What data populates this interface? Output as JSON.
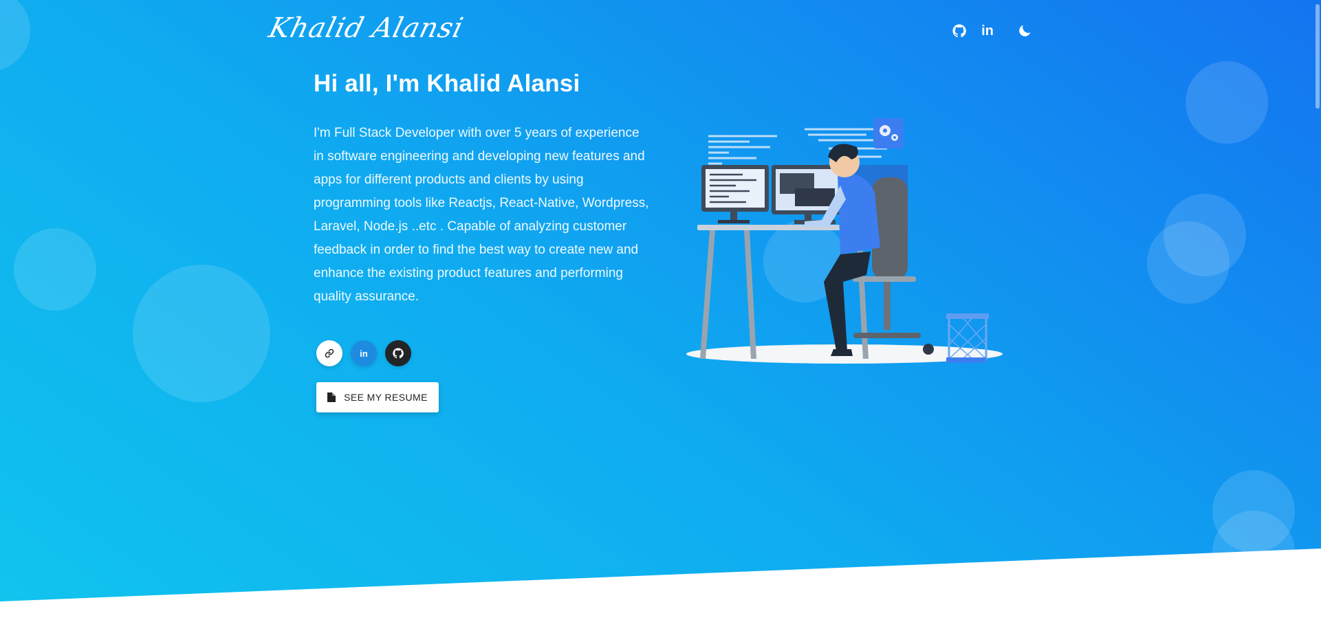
{
  "brand": {
    "logo_text": "Khalid Alansi"
  },
  "nav": {
    "icons": [
      "github-icon",
      "linkedin-icon",
      "moon-icon"
    ],
    "linkedin_glyph": "in"
  },
  "hero": {
    "headline": "Hi all, I'm Khalid Alansi",
    "bio": "I'm Full Stack Developer with over 5 years of experience in software engineering and developing new features and apps for different products and clients by using programming tools like Reactjs, React-Native, Wordpress, Laravel, Node.js ..etc . Capable of analyzing customer feedback in order to find the best way to create new and enhance the existing product features and performing quality assurance.",
    "social": {
      "icons": [
        "link-icon",
        "linkedin-icon",
        "github-icon"
      ],
      "linkedin_glyph": "in"
    },
    "resume_button": {
      "label": "SEE MY RESUME",
      "icon": "file-icon"
    }
  },
  "colors": {
    "gradient_start": "#11c5ee",
    "gradient_mid": "#0faaf0",
    "gradient_end": "#1474f0",
    "linkedin_blue": "#1d8ce0",
    "github_dark": "#222428"
  }
}
